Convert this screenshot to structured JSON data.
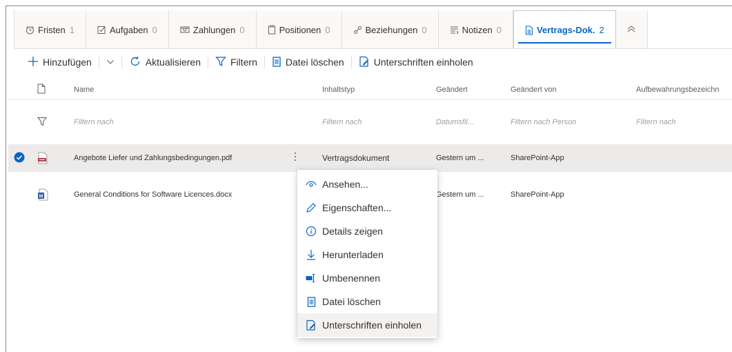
{
  "tabs": [
    {
      "label": "Fristen",
      "count": "1",
      "icon": "clock-icon"
    },
    {
      "label": "Aufgaben",
      "count": "0",
      "icon": "checkbox-icon"
    },
    {
      "label": "Zahlungen",
      "count": "0",
      "icon": "money-icon"
    },
    {
      "label": "Positionen",
      "count": "0",
      "icon": "clipboard-icon"
    },
    {
      "label": "Beziehungen",
      "count": "0",
      "icon": "link-icon"
    },
    {
      "label": "Notizen",
      "count": "0",
      "icon": "notes-icon"
    },
    {
      "label": "Vertrags-Dok.",
      "count": "2",
      "icon": "document-icon",
      "active": true
    }
  ],
  "commands": {
    "add": "Hinzufügen",
    "refresh": "Aktualisieren",
    "filter": "Filtern",
    "delete": "Datei löschen",
    "signatures": "Unterschriften einholen"
  },
  "columns": {
    "name": "Name",
    "content_type": "Inhaltstyp",
    "modified": "Geändert",
    "modified_by": "Geändert von",
    "retention": "Aufbewahrungsbezeichn"
  },
  "filters": {
    "name": "Filtern nach",
    "content_type": "Filtern nach",
    "modified": "Datumsfil...",
    "modified_by": "Filtern nach Person",
    "retention": "Filtern nach"
  },
  "rows": [
    {
      "name": "Angebote Liefer und Zahlungsbedingungen.pdf",
      "content_type": "Vertragsdokument",
      "modified": "Gestern um ...",
      "modified_by": "SharePoint-App",
      "file_type": "pdf",
      "selected": true
    },
    {
      "name": "General Conditions for Software Licences.docx",
      "content_type": "",
      "modified": "Gestern um ...",
      "modified_by": "SharePoint-App",
      "file_type": "docx",
      "selected": false
    }
  ],
  "context_menu": [
    {
      "label": "Ansehen...",
      "icon": "eye-icon"
    },
    {
      "label": "Eigenschaften...",
      "icon": "pencil-icon"
    },
    {
      "label": "Details zeigen",
      "icon": "info-icon"
    },
    {
      "label": "Herunterladen",
      "icon": "download-icon"
    },
    {
      "label": "Umbenennen",
      "icon": "rename-icon"
    },
    {
      "label": "Datei löschen",
      "icon": "trash-icon"
    },
    {
      "label": "Unterschriften einholen",
      "icon": "signature-icon",
      "highlighted": true
    }
  ],
  "colors": {
    "accent": "#0a64c5",
    "pdf": "#c4314b",
    "word": "#2b579a"
  }
}
